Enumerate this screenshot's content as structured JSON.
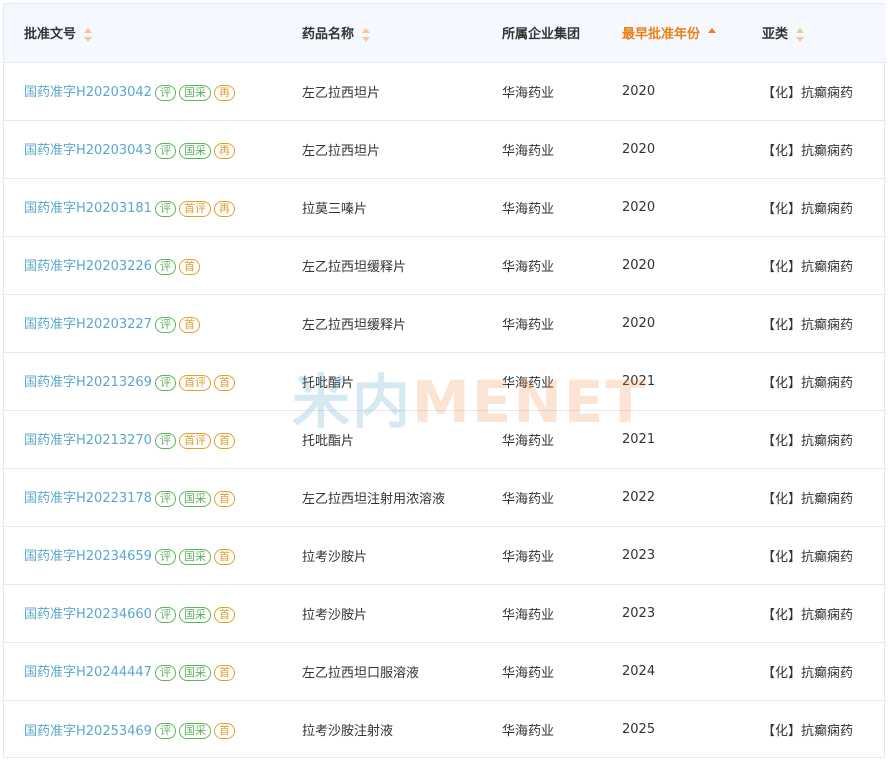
{
  "columns": {
    "approval_no": "批准文号",
    "drug_name": "药品名称",
    "company": "所属企业集团",
    "earliest_year": "最早批准年份",
    "subclass": "亚类"
  },
  "watermark": {
    "part1": "米内",
    "part2": "MENET"
  },
  "rows": [
    {
      "approval_no": "国药准字H20203042",
      "badges": [
        {
          "text": "评",
          "color": "green"
        },
        {
          "text": "国采",
          "color": "green"
        },
        {
          "text": "再",
          "color": "orange"
        }
      ],
      "drug_name": "左乙拉西坦片",
      "company": "华海药业",
      "year": "2020",
      "subclass": "【化】抗癫痫药"
    },
    {
      "approval_no": "国药准字H20203043",
      "badges": [
        {
          "text": "评",
          "color": "green"
        },
        {
          "text": "国采",
          "color": "green"
        },
        {
          "text": "再",
          "color": "orange"
        }
      ],
      "drug_name": "左乙拉西坦片",
      "company": "华海药业",
      "year": "2020",
      "subclass": "【化】抗癫痫药"
    },
    {
      "approval_no": "国药准字H20203181",
      "badges": [
        {
          "text": "评",
          "color": "green"
        },
        {
          "text": "首评",
          "color": "orange"
        },
        {
          "text": "再",
          "color": "orange"
        }
      ],
      "drug_name": "拉莫三嗪片",
      "company": "华海药业",
      "year": "2020",
      "subclass": "【化】抗癫痫药"
    },
    {
      "approval_no": "国药准字H20203226",
      "badges": [
        {
          "text": "评",
          "color": "green"
        },
        {
          "text": "首",
          "color": "orange"
        }
      ],
      "drug_name": "左乙拉西坦缓释片",
      "company": "华海药业",
      "year": "2020",
      "subclass": "【化】抗癫痫药"
    },
    {
      "approval_no": "国药准字H20203227",
      "badges": [
        {
          "text": "评",
          "color": "green"
        },
        {
          "text": "首",
          "color": "orange"
        }
      ],
      "drug_name": "左乙拉西坦缓释片",
      "company": "华海药业",
      "year": "2020",
      "subclass": "【化】抗癫痫药"
    },
    {
      "approval_no": "国药准字H20213269",
      "badges": [
        {
          "text": "评",
          "color": "green"
        },
        {
          "text": "首评",
          "color": "orange"
        },
        {
          "text": "首",
          "color": "orange"
        }
      ],
      "drug_name": "托吡酯片",
      "company": "华海药业",
      "year": "2021",
      "subclass": "【化】抗癫痫药"
    },
    {
      "approval_no": "国药准字H20213270",
      "badges": [
        {
          "text": "评",
          "color": "green"
        },
        {
          "text": "首评",
          "color": "orange"
        },
        {
          "text": "首",
          "color": "orange"
        }
      ],
      "drug_name": "托吡酯片",
      "company": "华海药业",
      "year": "2021",
      "subclass": "【化】抗癫痫药"
    },
    {
      "approval_no": "国药准字H20223178",
      "badges": [
        {
          "text": "评",
          "color": "green"
        },
        {
          "text": "国采",
          "color": "green"
        },
        {
          "text": "首",
          "color": "orange"
        }
      ],
      "drug_name": "左乙拉西坦注射用浓溶液",
      "company": "华海药业",
      "year": "2022",
      "subclass": "【化】抗癫痫药"
    },
    {
      "approval_no": "国药准字H20234659",
      "badges": [
        {
          "text": "评",
          "color": "green"
        },
        {
          "text": "国采",
          "color": "green"
        },
        {
          "text": "首",
          "color": "orange"
        }
      ],
      "drug_name": "拉考沙胺片",
      "company": "华海药业",
      "year": "2023",
      "subclass": "【化】抗癫痫药"
    },
    {
      "approval_no": "国药准字H20234660",
      "badges": [
        {
          "text": "评",
          "color": "green"
        },
        {
          "text": "国采",
          "color": "green"
        },
        {
          "text": "首",
          "color": "orange"
        }
      ],
      "drug_name": "拉考沙胺片",
      "company": "华海药业",
      "year": "2023",
      "subclass": "【化】抗癫痫药"
    },
    {
      "approval_no": "国药准字H20244447",
      "badges": [
        {
          "text": "评",
          "color": "green"
        },
        {
          "text": "国采",
          "color": "green"
        },
        {
          "text": "首",
          "color": "orange"
        }
      ],
      "drug_name": "左乙拉西坦口服溶液",
      "company": "华海药业",
      "year": "2024",
      "subclass": "【化】抗癫痫药"
    },
    {
      "approval_no": "国药准字H20253469",
      "badges": [
        {
          "text": "评",
          "color": "green"
        },
        {
          "text": "国采",
          "color": "green"
        },
        {
          "text": "首",
          "color": "orange"
        }
      ],
      "drug_name": "拉考沙胺注射液",
      "company": "华海药业",
      "year": "2025",
      "subclass": "【化】抗癫痫药"
    }
  ]
}
